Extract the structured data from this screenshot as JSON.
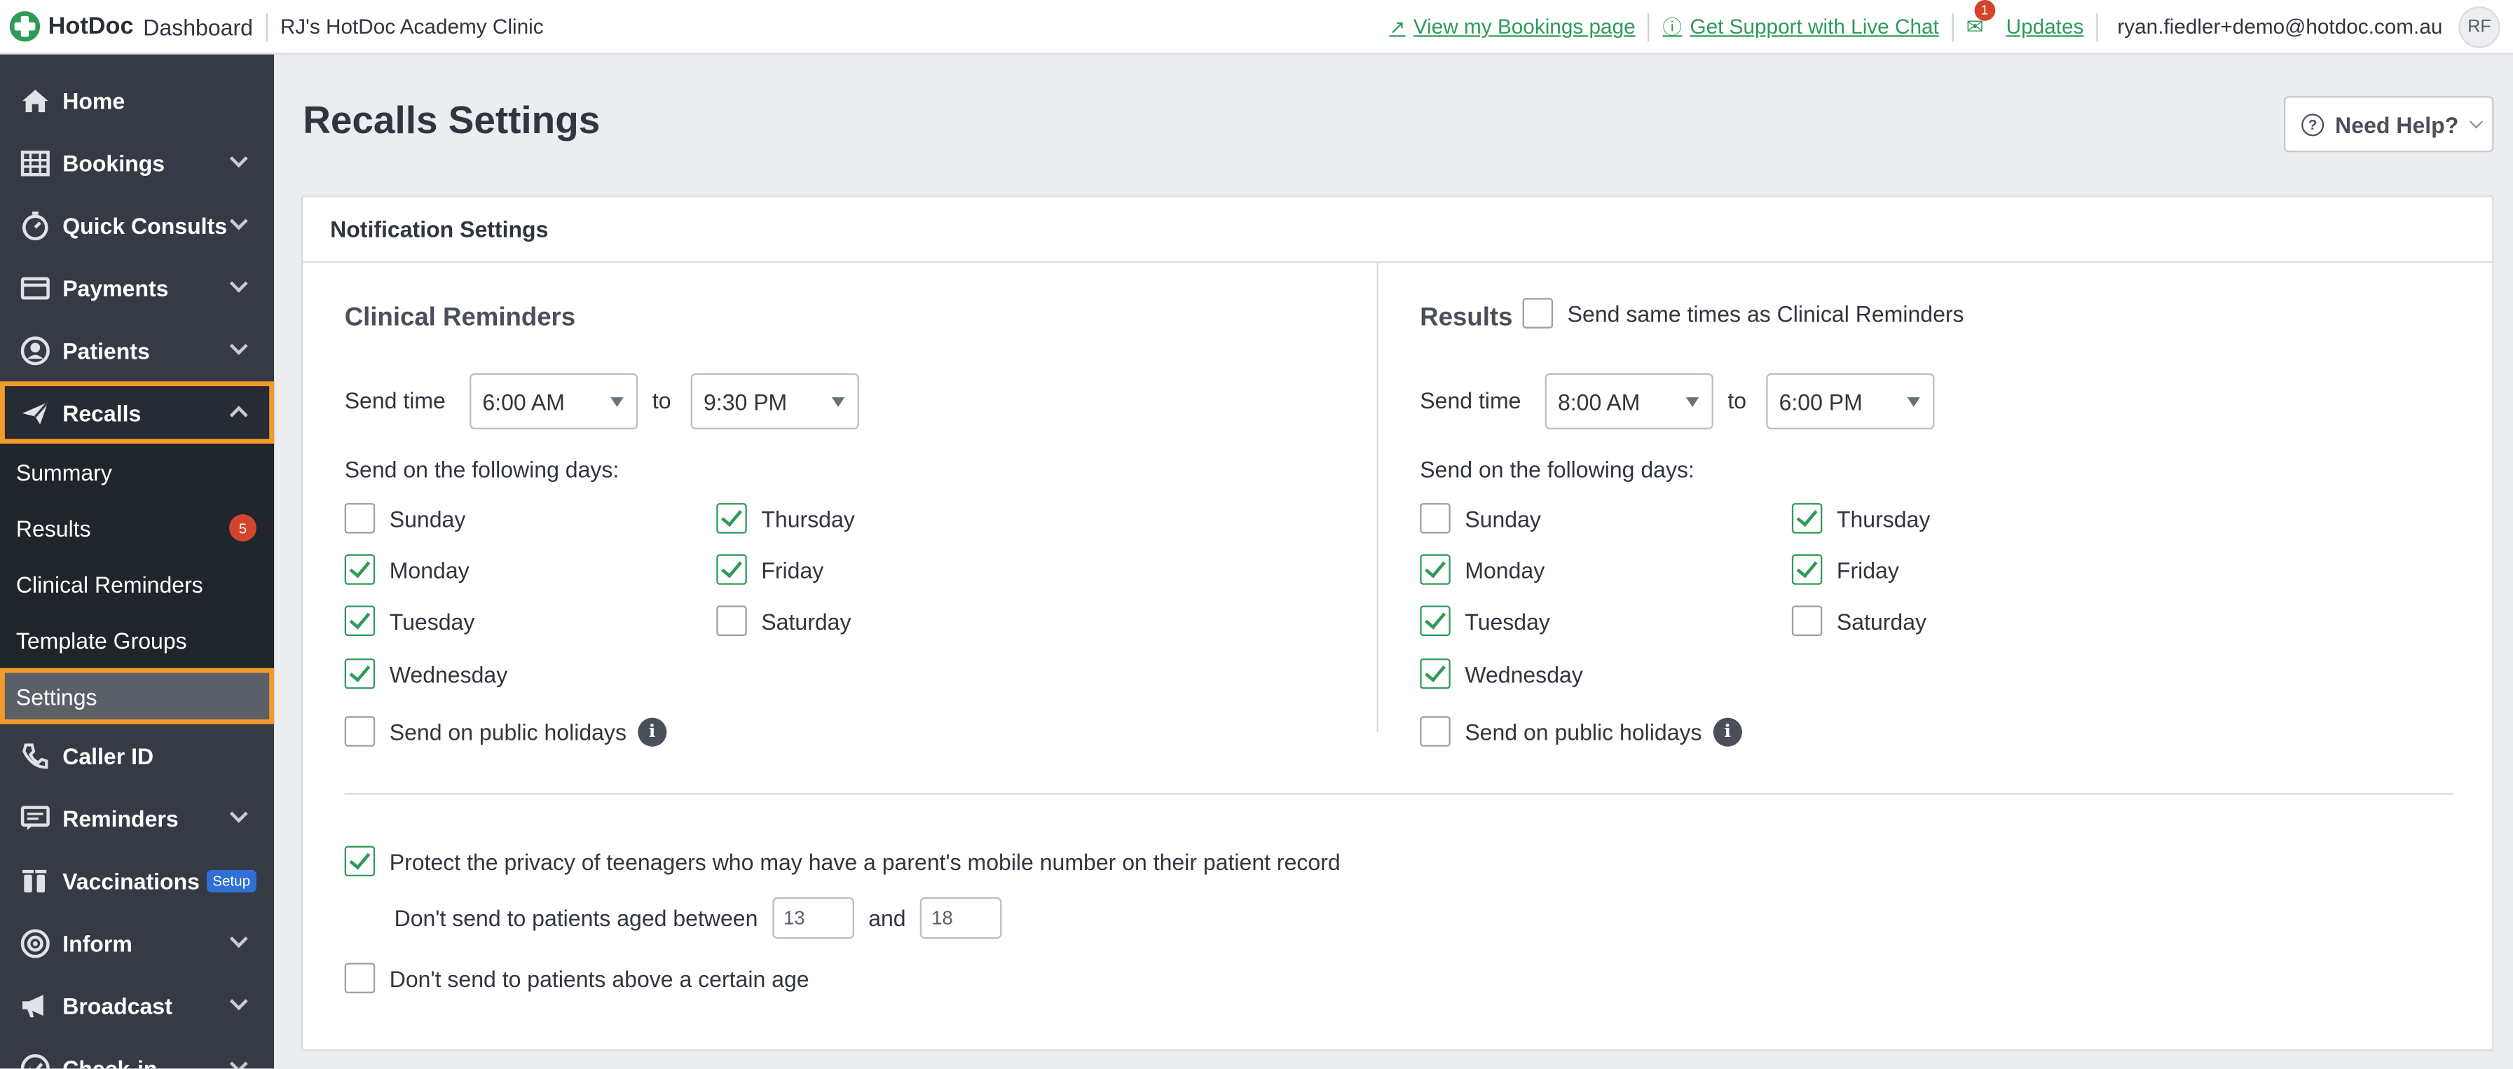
{
  "topbar": {
    "logo_text": "HotDoc",
    "logo_sub": "Dashboard",
    "clinic": "RJ's HotDoc Academy Clinic",
    "bookings_link": "View my Bookings page",
    "support_link": "Get Support with Live Chat",
    "updates_count": "1",
    "updates_link": "Updates",
    "user_email": "ryan.fiedler+demo@hotdoc.com.au",
    "avatar_initials": "RF"
  },
  "sidebar": {
    "home": "Home",
    "bookings": "Bookings",
    "quick_consults": "Quick Consults",
    "payments": "Payments",
    "patients": "Patients",
    "recalls": "Recalls",
    "recalls_sub": {
      "summary": "Summary",
      "results": "Results",
      "results_count": "5",
      "clinical_reminders": "Clinical Reminders",
      "template_groups": "Template Groups",
      "settings": "Settings"
    },
    "caller_id": "Caller ID",
    "reminders": "Reminders",
    "vaccinations": "Vaccinations",
    "vaccinations_badge": "Setup",
    "inform": "Inform",
    "broadcast": "Broadcast",
    "check_in": "Check-in"
  },
  "main": {
    "title": "Recalls Settings",
    "help_button": "Need Help?",
    "card_title": "Notification Settings",
    "clinical": {
      "title": "Clinical Reminders",
      "send_time_label": "Send time",
      "from": "6:00 AM",
      "to_label": "to",
      "to": "9:30 PM",
      "days_label": "Send on the following days:",
      "days": {
        "sunday": "Sunday",
        "monday": "Monday",
        "tuesday": "Tuesday",
        "wednesday": "Wednesday",
        "thursday": "Thursday",
        "friday": "Friday",
        "saturday": "Saturday"
      },
      "holidays": "Send on public holidays"
    },
    "results": {
      "title": "Results",
      "same_times": "Send same times as Clinical Reminders",
      "send_time_label": "Send time",
      "from": "8:00 AM",
      "to_label": "to",
      "to": "6:00 PM",
      "days_label": "Send on the following days:",
      "days": {
        "sunday": "Sunday",
        "monday": "Monday",
        "tuesday": "Tuesday",
        "wednesday": "Wednesday",
        "thursday": "Thursday",
        "friday": "Friday",
        "saturday": "Saturday"
      },
      "holidays": "Send on public holidays"
    },
    "privacy": {
      "protect_label": "Protect the privacy of teenagers who may have a parent's mobile number on their patient record",
      "age_between_label": "Don't send to patients aged between",
      "age_min": "13",
      "and_label": "and",
      "age_max": "18",
      "above_age_label": "Don't send to patients above a certain age"
    }
  }
}
